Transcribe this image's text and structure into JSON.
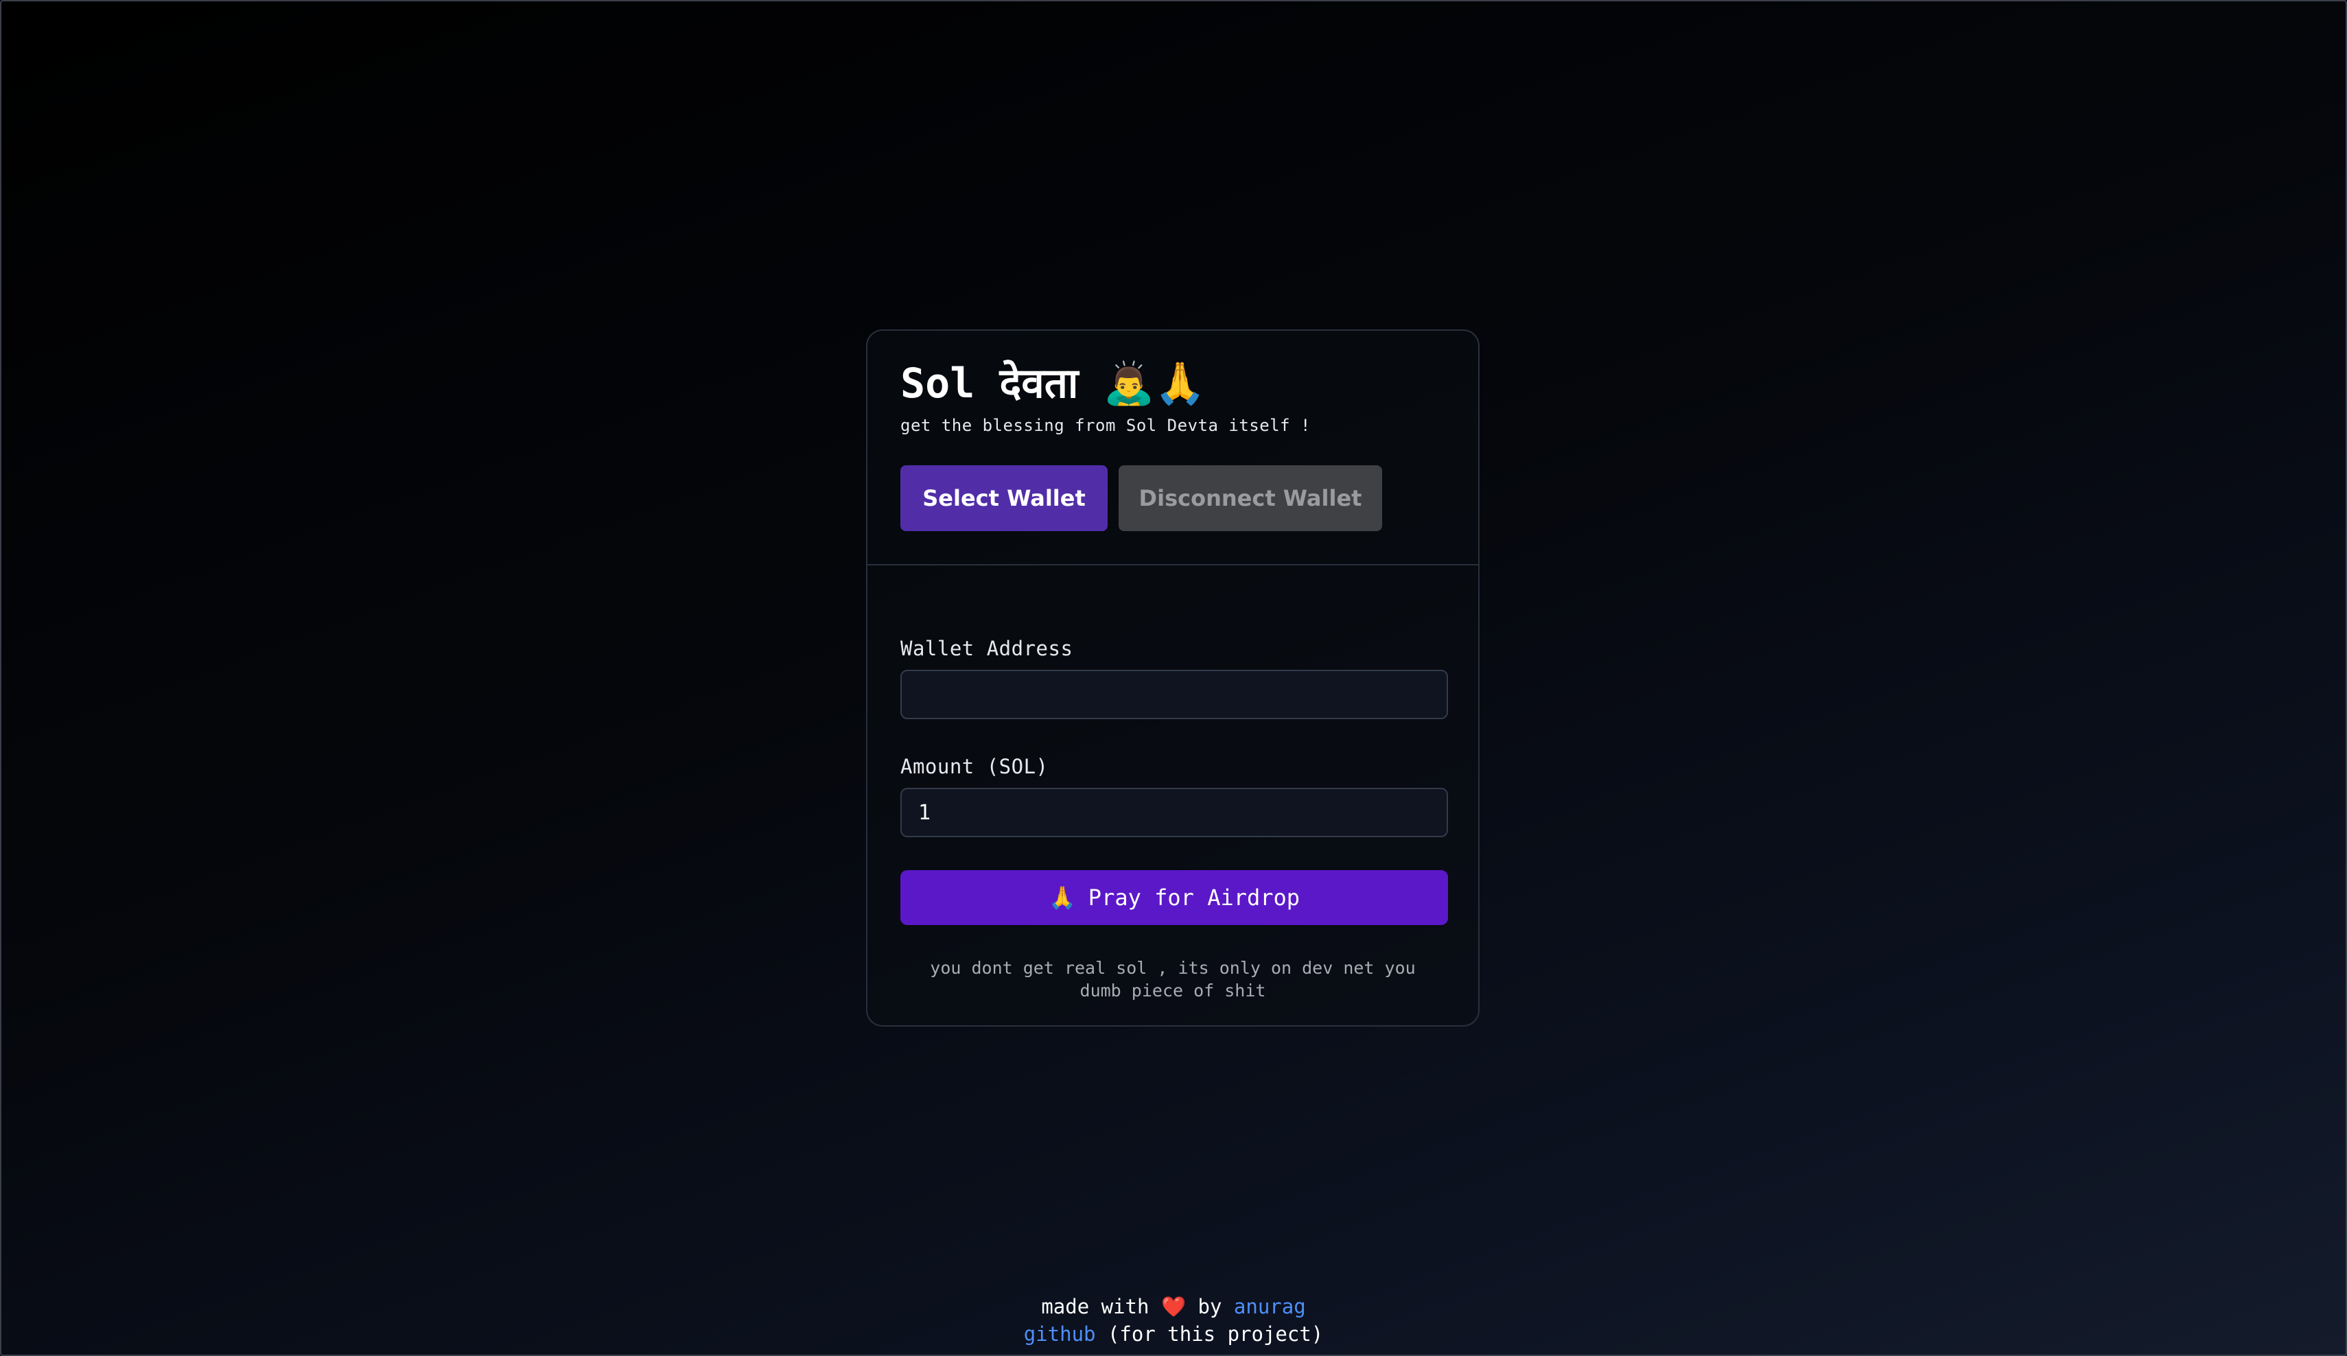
{
  "header": {
    "title": "Sol देवता 🙇‍♂️🙏",
    "subtitle": "get the blessing from Sol Devta itself !"
  },
  "wallet_buttons": {
    "select_label": "Select Wallet",
    "disconnect_label": "Disconnect Wallet"
  },
  "form": {
    "wallet_address": {
      "label": "Wallet Address",
      "value": ""
    },
    "amount": {
      "label": "Amount (SOL)",
      "value": "1"
    },
    "submit": {
      "icon": "🙏",
      "label": "Pray for Airdrop"
    },
    "disclaimer": "you dont get real sol , its only on dev net you dumb piece of shit"
  },
  "footer": {
    "made_with": "made with",
    "heart": "❤️",
    "by": "by",
    "author_link": "anurag",
    "github_link": "github",
    "project_note": "(for this project)"
  },
  "colors": {
    "select_button": "#512da8",
    "disconnect_button": "#404144",
    "pray_button": "#5b18c8",
    "link": "#4f8ff7"
  }
}
